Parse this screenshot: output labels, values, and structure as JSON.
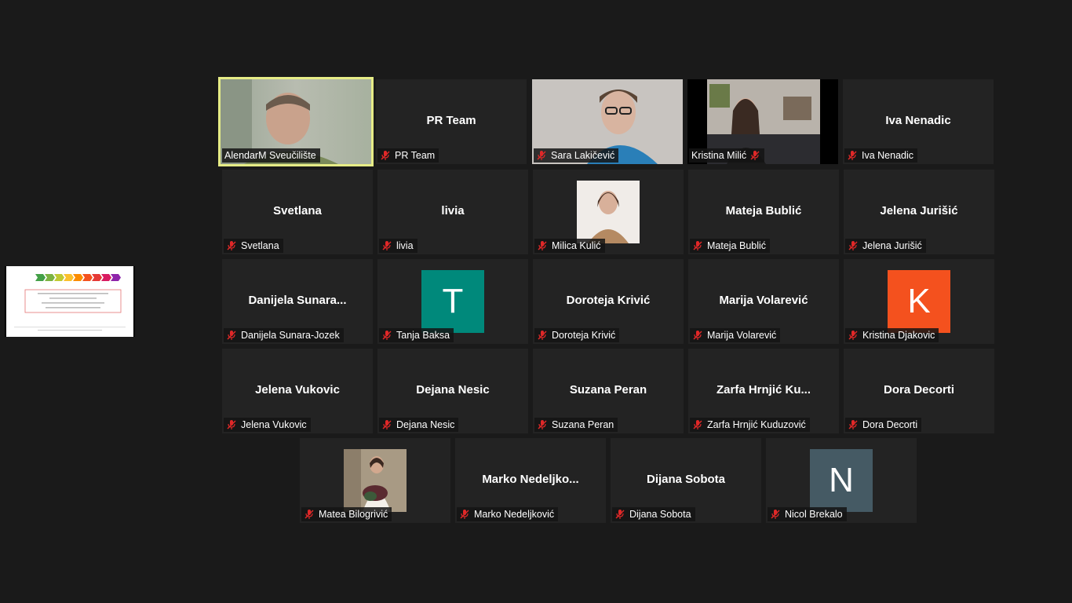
{
  "participants": [
    {
      "id": "p1",
      "tile_name": "",
      "label": "AlendarM Sveučilište",
      "kind": "video",
      "active": true
    },
    {
      "id": "p2",
      "tile_name": "PR Team",
      "label": "PR Team",
      "kind": "name"
    },
    {
      "id": "p3",
      "tile_name": "",
      "label": "Sara Lakičević",
      "kind": "video"
    },
    {
      "id": "p4",
      "tile_name": "",
      "label": "Kristina Milić",
      "kind": "video"
    },
    {
      "id": "p5",
      "tile_name": "Iva Nenadic",
      "label": "Iva Nenadic",
      "kind": "name"
    },
    {
      "id": "p6",
      "tile_name": "Svetlana",
      "label": "Svetlana",
      "kind": "name"
    },
    {
      "id": "p7",
      "tile_name": "livia",
      "label": "livia",
      "kind": "name"
    },
    {
      "id": "p8",
      "tile_name": "",
      "label": "Milica Kulić",
      "kind": "photo"
    },
    {
      "id": "p9",
      "tile_name": "Mateja Bublić",
      "label": "Mateja Bublić",
      "kind": "name"
    },
    {
      "id": "p10",
      "tile_name": "Jelena Jurišić",
      "label": "Jelena Jurišić",
      "kind": "name"
    },
    {
      "id": "p11",
      "tile_name": "Danijela  Sunara...",
      "label": "Danijela Sunara-Jozek",
      "kind": "name"
    },
    {
      "id": "p12",
      "tile_name": "",
      "label": "Tanja Baksa",
      "kind": "avatar",
      "letter": "T",
      "color": "#00897b"
    },
    {
      "id": "p13",
      "tile_name": "Doroteja Krivić",
      "label": "Doroteja Krivić",
      "kind": "name"
    },
    {
      "id": "p14",
      "tile_name": "Marija Volarević",
      "label": "Marija Volarević",
      "kind": "name"
    },
    {
      "id": "p15",
      "tile_name": "",
      "label": "Kristina Djakovic",
      "kind": "avatar",
      "letter": "K",
      "color": "#f4511e"
    },
    {
      "id": "p16",
      "tile_name": "Jelena Vukovic",
      "label": "Jelena Vukovic",
      "kind": "name"
    },
    {
      "id": "p17",
      "tile_name": "Dejana Nesic",
      "label": "Dejana Nesic",
      "kind": "name"
    },
    {
      "id": "p18",
      "tile_name": "Suzana Peran",
      "label": "Suzana Peran",
      "kind": "name"
    },
    {
      "id": "p19",
      "tile_name": "Zarfa  Hrnjić  Ku...",
      "label": "Zarfa Hrnjić Kuduzović",
      "kind": "name"
    },
    {
      "id": "p20",
      "tile_name": "Dora Decorti",
      "label": "Dora Decorti",
      "kind": "name"
    },
    {
      "id": "p21",
      "tile_name": "",
      "label": "Matea Bilogrivić",
      "kind": "photo"
    },
    {
      "id": "p22",
      "tile_name": "Marko  Nedeljko...",
      "label": "Marko Nedeljković",
      "kind": "name"
    },
    {
      "id": "p23",
      "tile_name": "Dijana Sobota",
      "label": "Dijana Sobota",
      "kind": "name"
    },
    {
      "id": "p24",
      "tile_name": "",
      "label": "Nicol Brekalo",
      "kind": "avatar",
      "letter": "N",
      "color": "#455a64"
    }
  ],
  "colors": {
    "active_border": "#e6ec86",
    "muted_mic": "#e02828",
    "tile_bg": "#232323",
    "page_bg": "#1a1a1a"
  }
}
